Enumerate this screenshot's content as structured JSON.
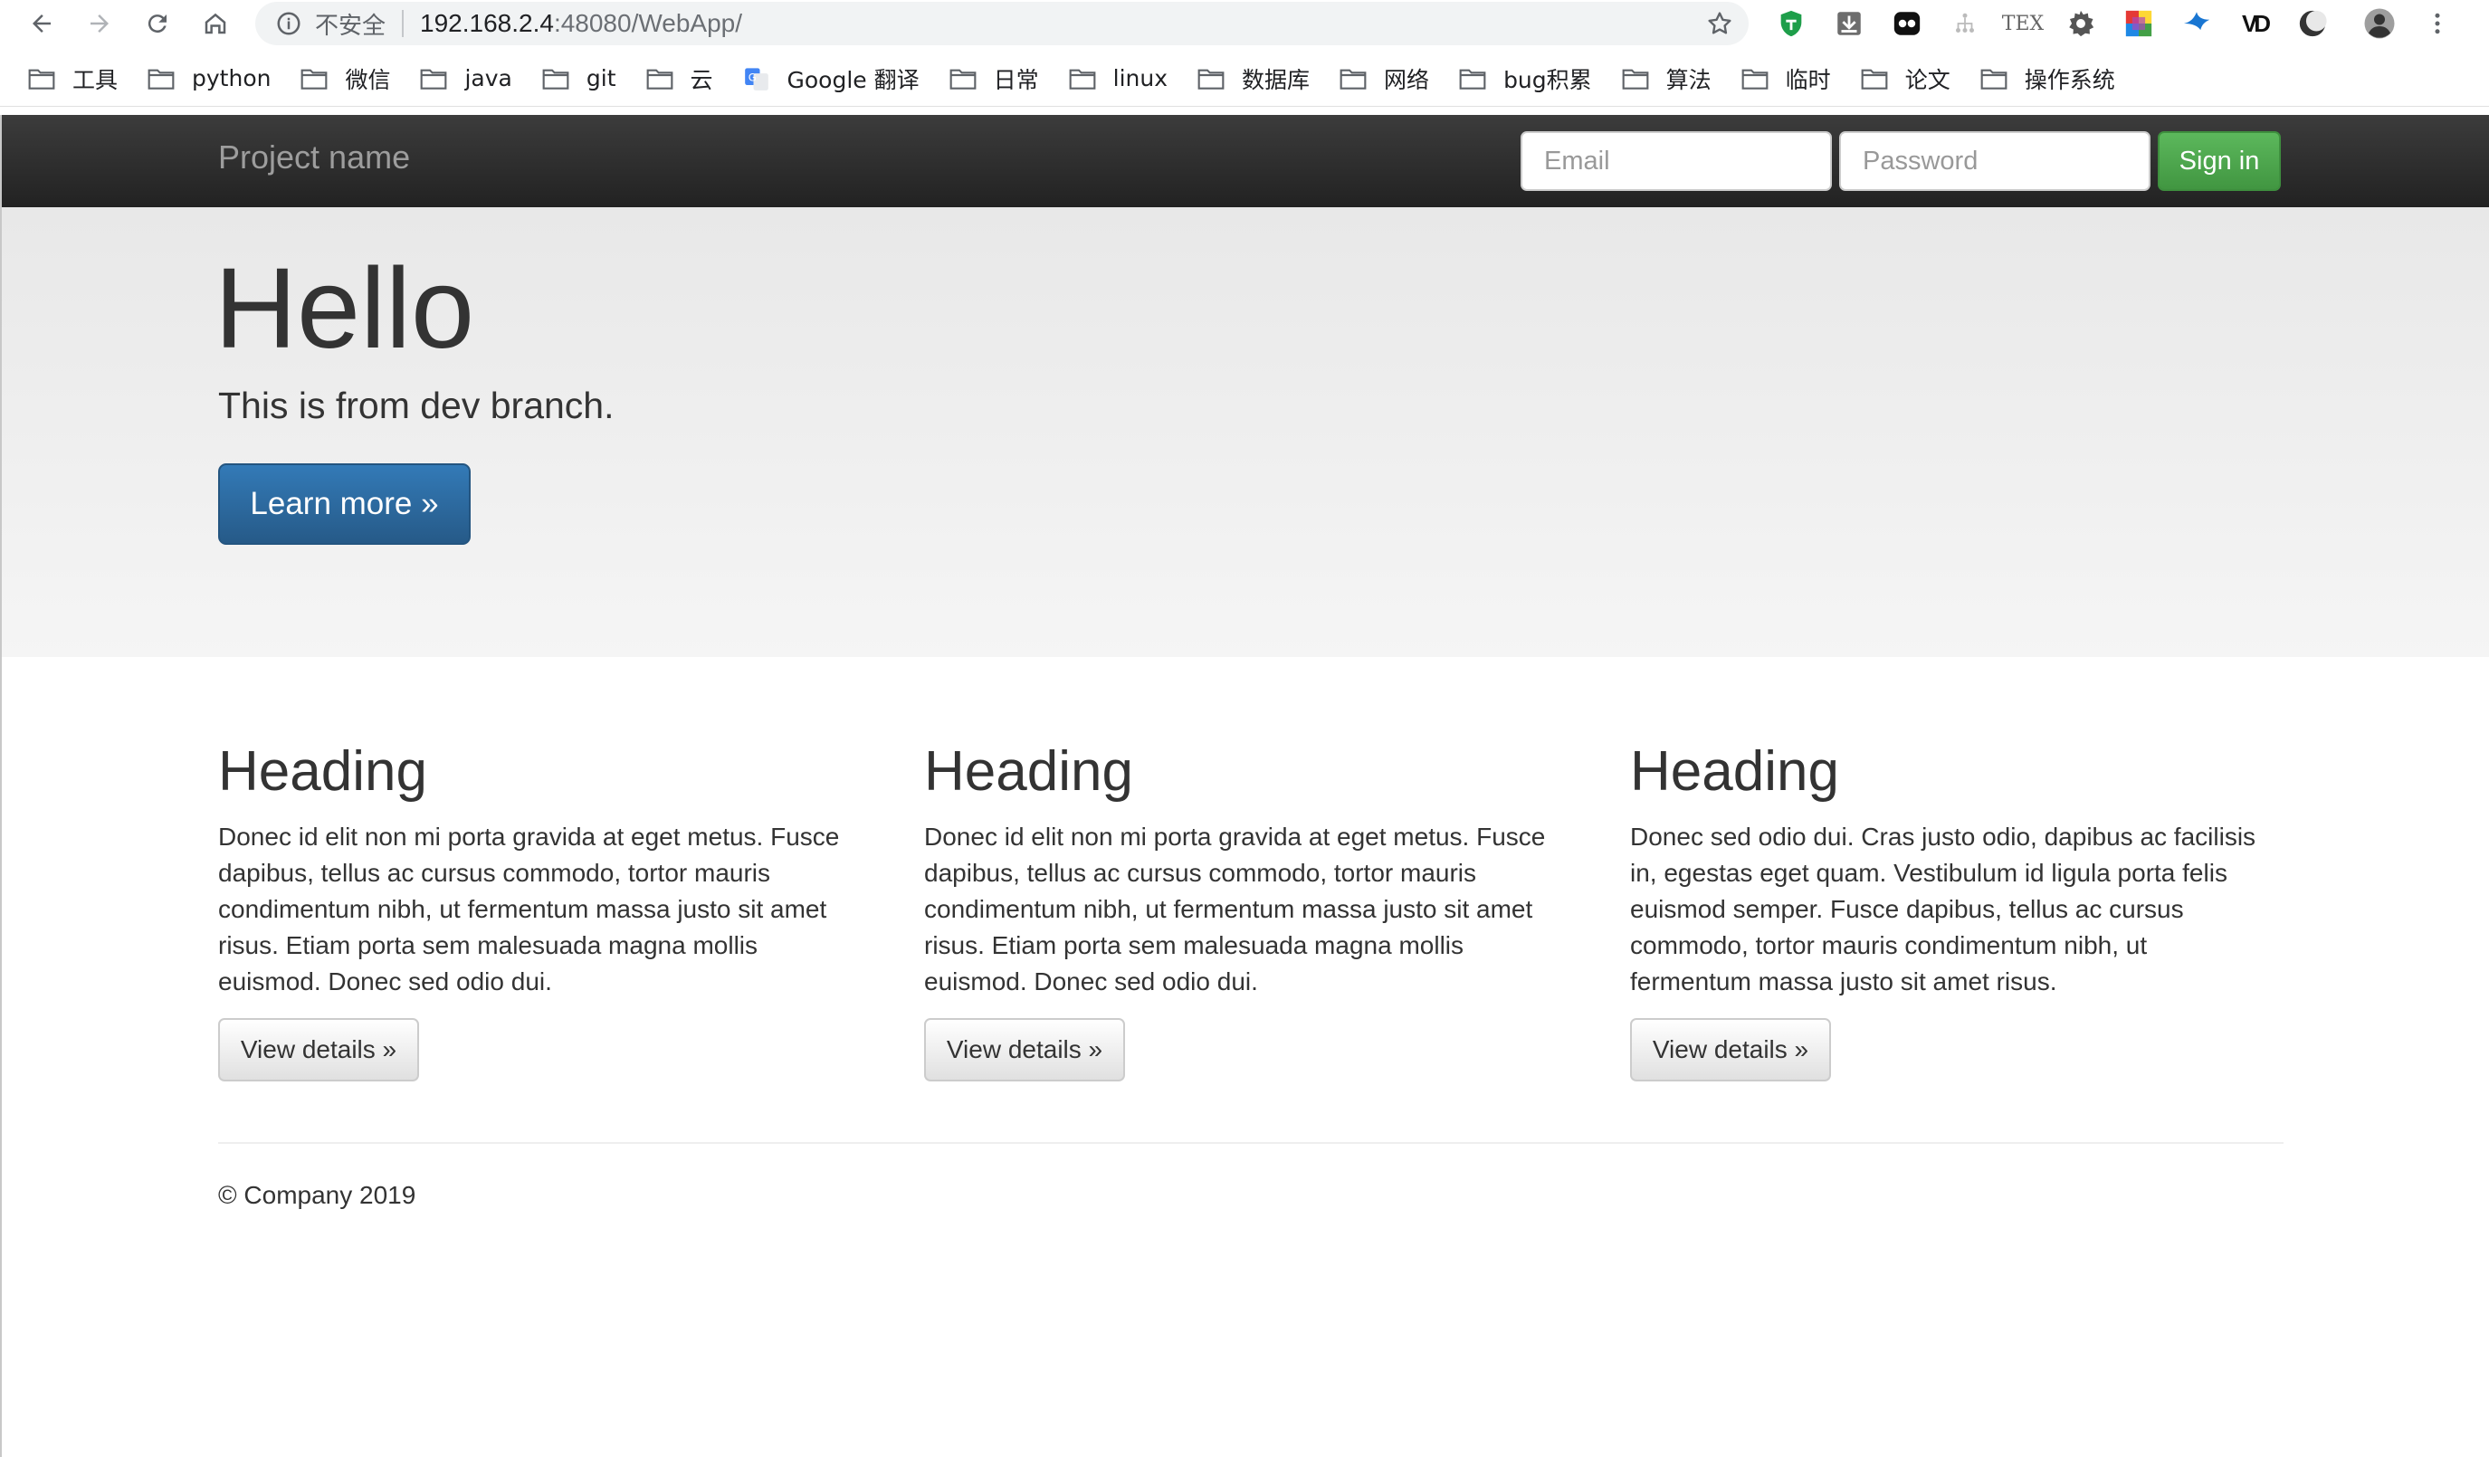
{
  "browser": {
    "security_label": "不安全",
    "url_host": "192.168.2.4",
    "url_rest": ":48080/WebApp/",
    "bookmarks": [
      {
        "label": "工具",
        "icon": "folder-icon"
      },
      {
        "label": "python",
        "icon": "folder-icon"
      },
      {
        "label": "微信",
        "icon": "folder-icon"
      },
      {
        "label": "java",
        "icon": "folder-icon"
      },
      {
        "label": "git",
        "icon": "folder-icon"
      },
      {
        "label": "云",
        "icon": "folder-icon"
      },
      {
        "label": "Google 翻译",
        "icon": "google-translate-icon"
      },
      {
        "label": "日常",
        "icon": "folder-icon"
      },
      {
        "label": "linux",
        "icon": "folder-icon"
      },
      {
        "label": "数据库",
        "icon": "folder-icon"
      },
      {
        "label": "网络",
        "icon": "folder-icon"
      },
      {
        "label": "bug积累",
        "icon": "folder-icon"
      },
      {
        "label": "算法",
        "icon": "folder-icon"
      },
      {
        "label": "临时",
        "icon": "folder-icon"
      },
      {
        "label": "论文",
        "icon": "folder-icon"
      },
      {
        "label": "操作系统",
        "icon": "folder-icon"
      }
    ],
    "extensions": [
      "shield-extension-icon",
      "download-extension-icon",
      "dots-extension-icon",
      "tree-extension-icon",
      "tex-extension-icon",
      "gear-extension-icon",
      "color-grid-extension-icon",
      "bird-extension-icon",
      "vd-extension-icon",
      "moon-extension-icon",
      "profile-avatar-icon",
      "kebab-menu-icon"
    ],
    "tex_text": "TEX",
    "vd_text": "VD"
  },
  "navbar": {
    "brand": "Project name",
    "email_placeholder": "Email",
    "password_placeholder": "Password",
    "signin_label": "Sign in"
  },
  "jumbotron": {
    "title": "Hello",
    "text": "This is from dev branch.",
    "button_label": "Learn more »"
  },
  "columns": [
    {
      "heading": "Heading",
      "body": "Donec id elit non mi porta gravida at eget metus. Fusce dapibus, tellus ac cursus commodo, tortor mauris condimentum nibh, ut fermentum massa justo sit amet risus. Etiam porta sem malesuada magna mollis euismod. Donec sed odio dui.",
      "button": "View details »"
    },
    {
      "heading": "Heading",
      "body": "Donec id elit non mi porta gravida at eget metus. Fusce dapibus, tellus ac cursus commodo, tortor mauris condimentum nibh, ut fermentum massa justo sit amet risus. Etiam porta sem malesuada magna mollis euismod. Donec sed odio dui.",
      "button": "View details »"
    },
    {
      "heading": "Heading",
      "body": "Donec sed odio dui. Cras justo odio, dapibus ac facilisis in, egestas eget quam. Vestibulum id ligula porta felis euismod semper. Fusce dapibus, tellus ac cursus commodo, tortor mauris condimentum nibh, ut fermentum massa justo sit amet risus.",
      "button": "View details »"
    }
  ],
  "footer": "© Company 2019",
  "colors": {
    "navbar_bg": "#222222",
    "jumbotron_bg": "#eeeeee",
    "primary": "#337ab7",
    "success": "#5cb85c"
  }
}
